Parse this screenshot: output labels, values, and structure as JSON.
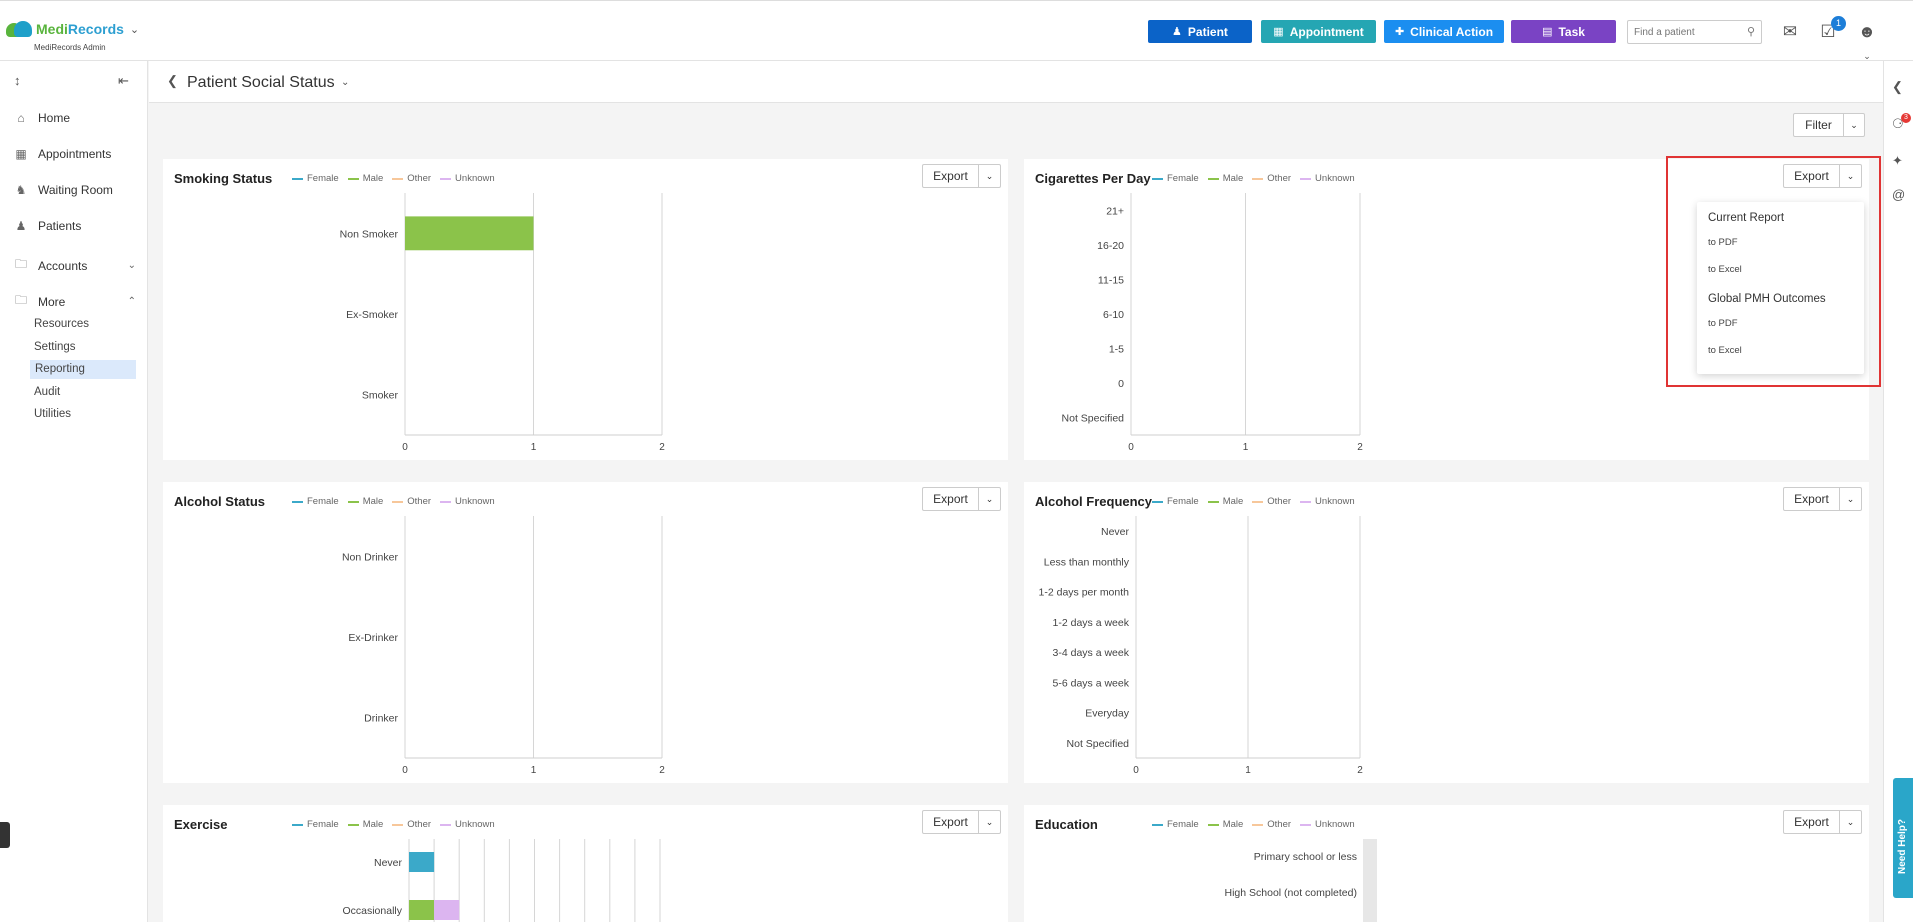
{
  "app": {
    "logo_medi": "Medi",
    "logo_records": "Records",
    "logo_sub": "MediRecords Admin",
    "colors": {
      "patient": "#0b63c8",
      "appointment": "#25a6b3",
      "clinical": "#1b8ef0",
      "task": "#7a43c4",
      "accent": "#1d7ed8"
    }
  },
  "topbar": {
    "buttons": [
      {
        "label": "Patient",
        "icon": "person-add-icon"
      },
      {
        "label": "Appointment",
        "icon": "calendar-icon"
      },
      {
        "label": "Clinical Action",
        "icon": "medical-case-icon"
      },
      {
        "label": "Task",
        "icon": "clipboard-icon"
      }
    ],
    "search_placeholder": "Find a patient",
    "task_badge": "1"
  },
  "sidebar": {
    "items": [
      {
        "label": "Home",
        "icon": "home-icon"
      },
      {
        "label": "Appointments",
        "icon": "calendar-icon"
      },
      {
        "label": "Waiting Room",
        "icon": "waiting-room-icon"
      },
      {
        "label": "Patients",
        "icon": "patients-icon"
      },
      {
        "label": "Accounts",
        "icon": "folder-icon"
      },
      {
        "label": "More",
        "icon": "folder-icon"
      }
    ],
    "subitems": [
      "Resources",
      "Settings",
      "Reporting",
      "Audit",
      "Utilities"
    ],
    "active_subitem": "Reporting"
  },
  "page": {
    "title": "Patient Social Status",
    "filter_label": "Filter",
    "rail_badge": "3",
    "need_help": "Need Help?"
  },
  "legend": [
    {
      "name": "Female",
      "color": "#3ba9c9"
    },
    {
      "name": "Male",
      "color": "#8bc34a"
    },
    {
      "name": "Other",
      "color": "#f7c79a"
    },
    {
      "name": "Unknown",
      "color": "#dcb5f0"
    }
  ],
  "export_label": "Export",
  "dropdown": {
    "sections": [
      {
        "heading": "Current Report",
        "items": [
          "to PDF",
          "to Excel"
        ]
      },
      {
        "heading": "Global PMH Outcomes",
        "items": [
          "to PDF",
          "to Excel"
        ]
      }
    ]
  },
  "chart_data": [
    {
      "type": "bar",
      "title": "Smoking Status",
      "orientation": "horizontal",
      "categories": [
        "Non Smoker",
        "Ex-Smoker",
        "Smoker"
      ],
      "series": [
        {
          "name": "Female",
          "values": [
            0,
            0,
            0
          ]
        },
        {
          "name": "Male",
          "values": [
            1,
            0,
            0
          ]
        },
        {
          "name": "Other",
          "values": [
            0,
            0,
            0
          ]
        },
        {
          "name": "Unknown",
          "values": [
            0,
            0,
            0
          ]
        }
      ],
      "xlim": [
        0,
        2
      ],
      "xticks": [
        "0",
        "1",
        "2"
      ],
      "legend": "top"
    },
    {
      "type": "bar",
      "title": "Cigarettes Per Day",
      "orientation": "horizontal",
      "categories": [
        "21+",
        "16-20",
        "11-15",
        "6-10",
        "1-5",
        "0",
        "Not Specified"
      ],
      "series": [
        {
          "name": "Female",
          "values": [
            0,
            0,
            0,
            0,
            0,
            0,
            0
          ]
        },
        {
          "name": "Male",
          "values": [
            0,
            0,
            0,
            0,
            0,
            0,
            0
          ]
        },
        {
          "name": "Other",
          "values": [
            0,
            0,
            0,
            0,
            0,
            0,
            0
          ]
        },
        {
          "name": "Unknown",
          "values": [
            0,
            0,
            0,
            0,
            0,
            0,
            0
          ]
        }
      ],
      "xlim": [
        0,
        2
      ],
      "xticks": [
        "0",
        "1",
        "2"
      ],
      "legend": "top"
    },
    {
      "type": "bar",
      "title": "Alcohol Status",
      "orientation": "horizontal",
      "categories": [
        "Non Drinker",
        "Ex-Drinker",
        "Drinker"
      ],
      "series": [
        {
          "name": "Female",
          "values": [
            0,
            0,
            0
          ]
        },
        {
          "name": "Male",
          "values": [
            0,
            0,
            0
          ]
        },
        {
          "name": "Other",
          "values": [
            0,
            0,
            0
          ]
        },
        {
          "name": "Unknown",
          "values": [
            0,
            0,
            0
          ]
        }
      ],
      "xlim": [
        0,
        2
      ],
      "xticks": [
        "0",
        "1",
        "2"
      ],
      "legend": "top"
    },
    {
      "type": "bar",
      "title": "Alcohol Frequency",
      "orientation": "horizontal",
      "categories": [
        "Never",
        "Less than monthly",
        "1-2 days per month",
        "1-2 days a week",
        "3-4 days a week",
        "5-6 days a week",
        "Everyday",
        "Not Specified"
      ],
      "series": [
        {
          "name": "Female",
          "values": [
            0,
            0,
            0,
            0,
            0,
            0,
            0,
            0
          ]
        },
        {
          "name": "Male",
          "values": [
            0,
            0,
            0,
            0,
            0,
            0,
            0,
            0
          ]
        },
        {
          "name": "Other",
          "values": [
            0,
            0,
            0,
            0,
            0,
            0,
            0,
            0
          ]
        },
        {
          "name": "Unknown",
          "values": [
            0,
            0,
            0,
            0,
            0,
            0,
            0,
            0
          ]
        }
      ],
      "xlim": [
        0,
        2
      ],
      "xticks": [
        "0",
        "1",
        "2"
      ],
      "legend": "top"
    },
    {
      "type": "bar",
      "title": "Exercise",
      "orientation": "horizontal",
      "categories": [
        "Never",
        "Occasionally"
      ],
      "series": [
        {
          "name": "Female",
          "values": [
            1,
            0
          ]
        },
        {
          "name": "Male",
          "values": [
            0,
            1
          ]
        },
        {
          "name": "Other",
          "values": [
            0,
            0
          ]
        },
        {
          "name": "Unknown",
          "values": [
            0,
            1
          ]
        }
      ],
      "xlim": [
        0,
        10
      ],
      "legend": "top"
    },
    {
      "type": "bar",
      "title": "Education",
      "orientation": "horizontal",
      "categories": [
        "Primary school or less",
        "High School (not completed)"
      ],
      "series": [
        {
          "name": "Female",
          "values": [
            0,
            0
          ]
        },
        {
          "name": "Male",
          "values": [
            0,
            0
          ]
        },
        {
          "name": "Other",
          "values": [
            0,
            0
          ]
        },
        {
          "name": "Unknown",
          "values": [
            0,
            0
          ]
        }
      ],
      "legend": "top"
    }
  ]
}
